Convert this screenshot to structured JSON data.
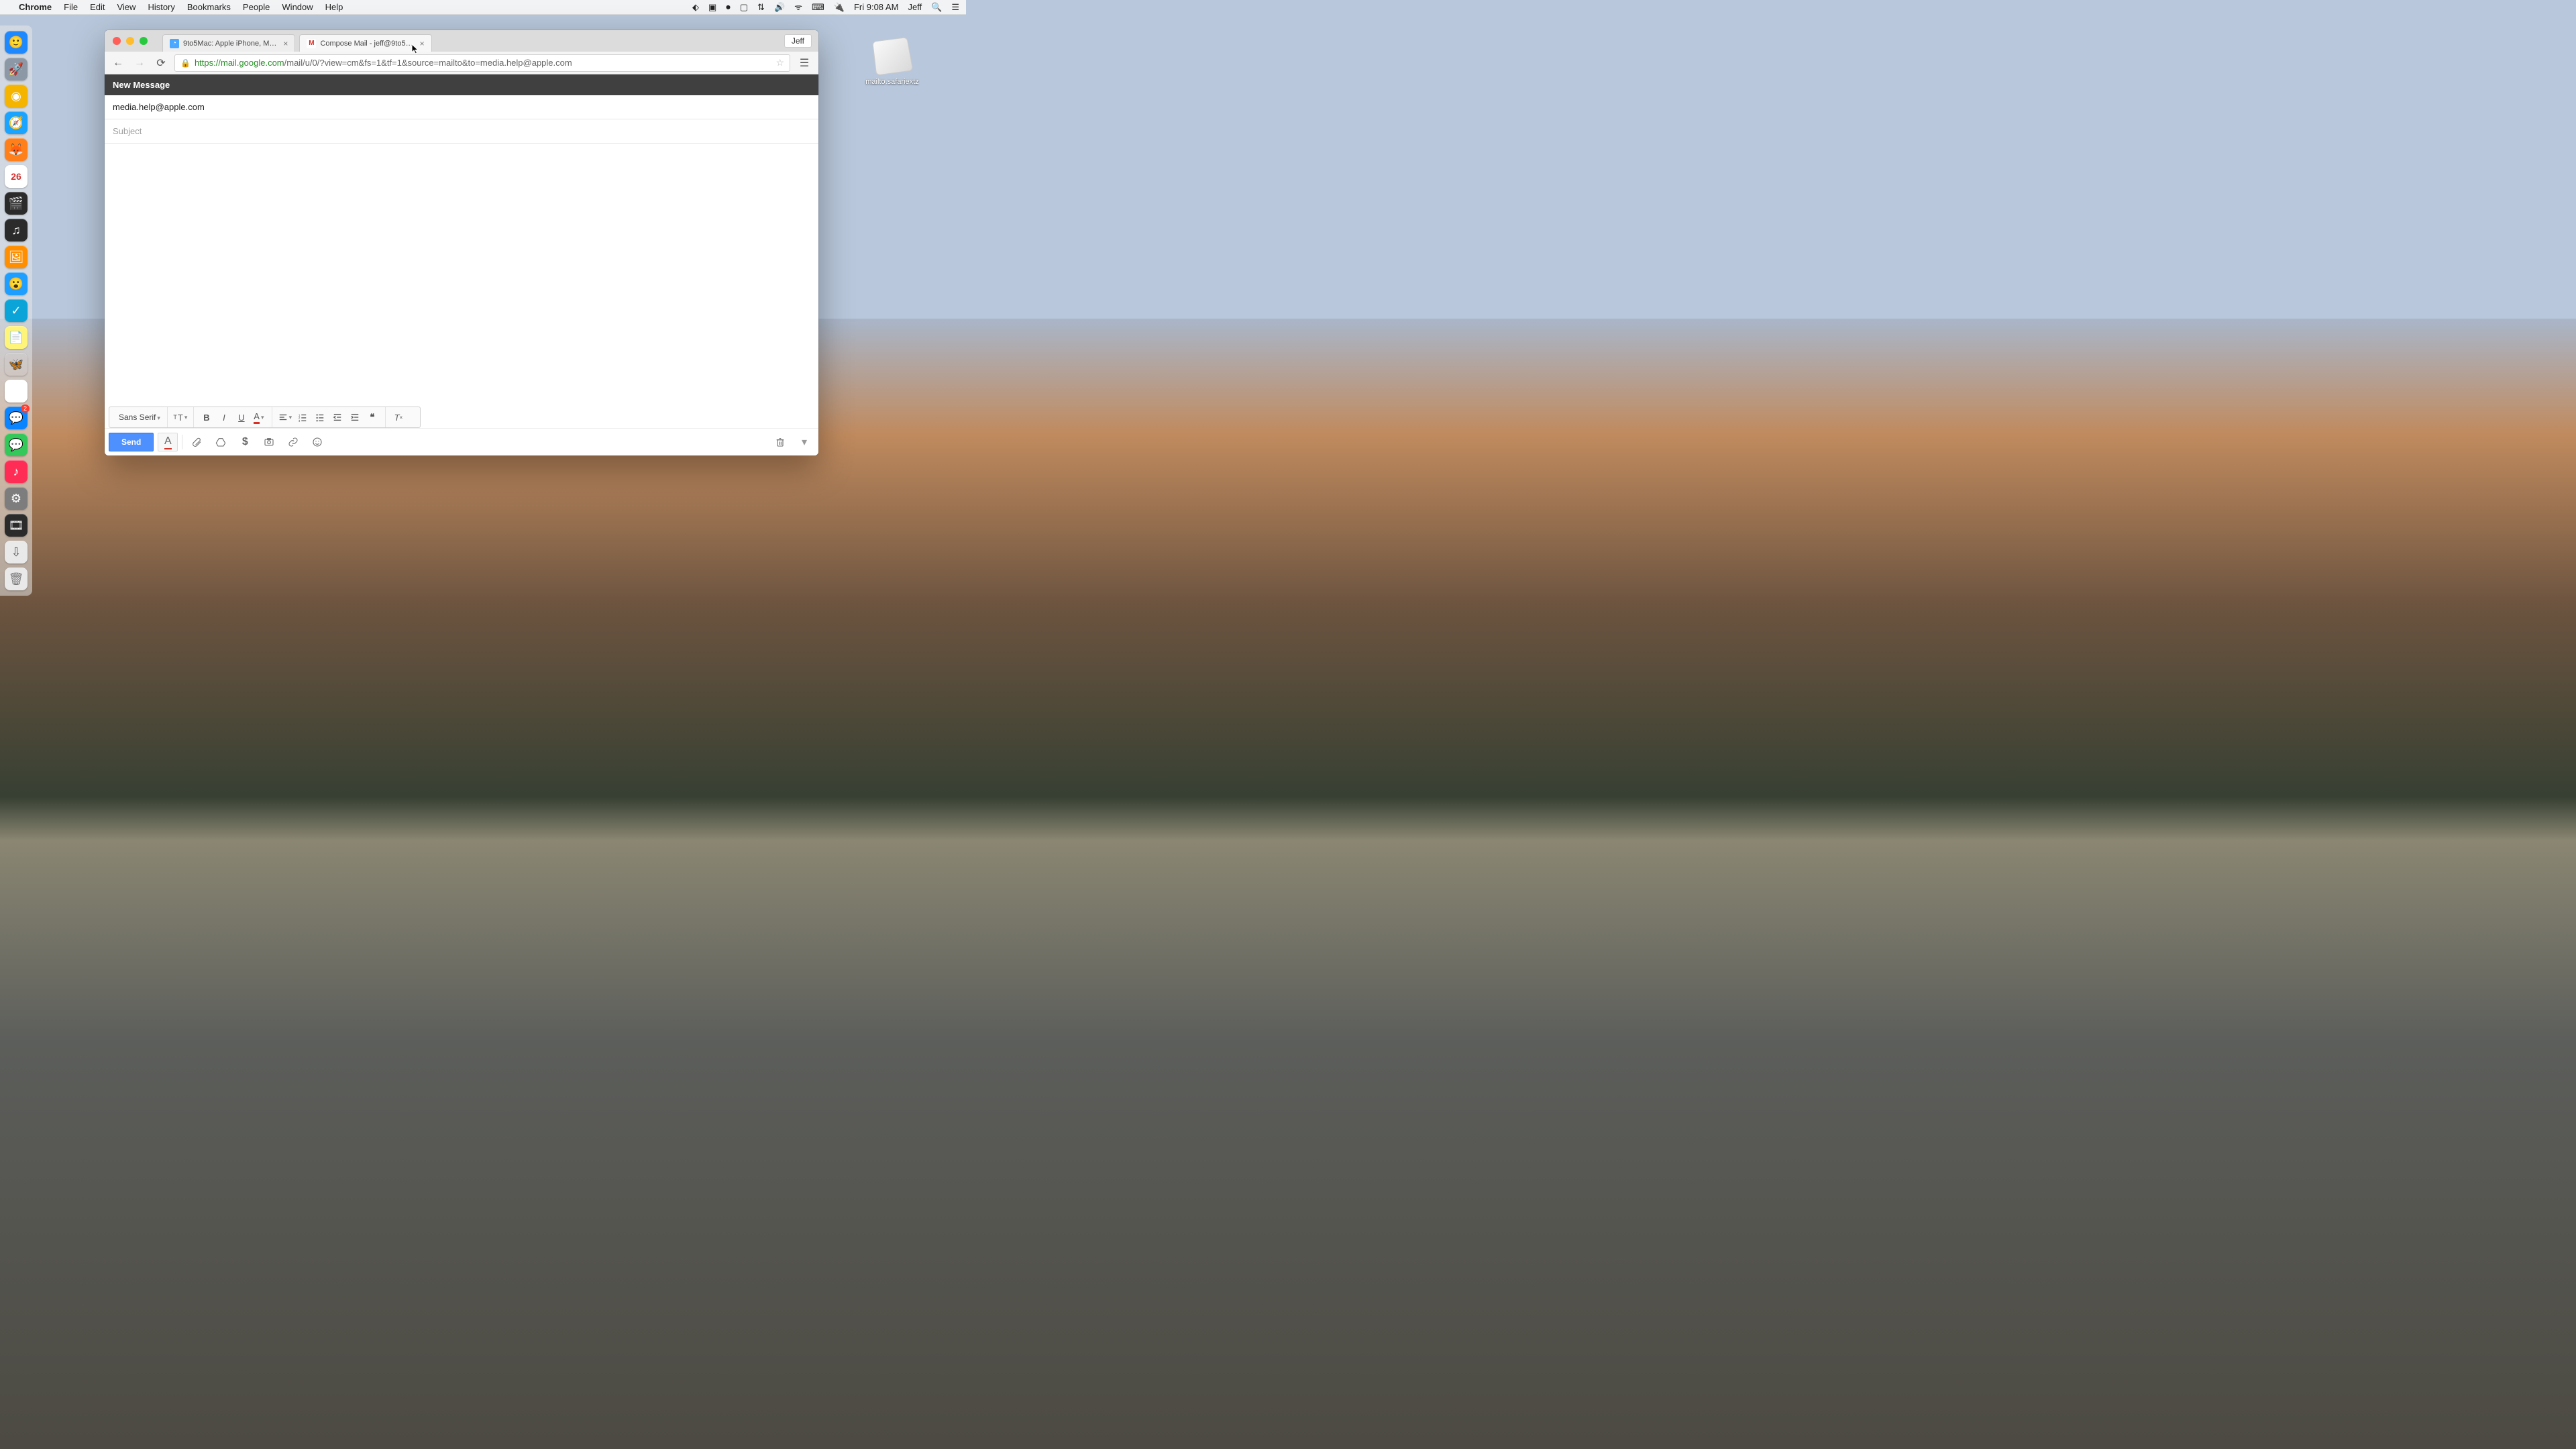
{
  "menubar": {
    "app": "Chrome",
    "items": [
      "File",
      "Edit",
      "View",
      "History",
      "Bookmarks",
      "People",
      "Window",
      "Help"
    ],
    "clock": "Fri 9:08 AM",
    "user": "Jeff"
  },
  "dock": {
    "items": [
      {
        "name": "finder",
        "glyph": "🙂",
        "bg": "#1e88ff"
      },
      {
        "name": "launchpad",
        "glyph": "🚀",
        "bg": "#8d98a6"
      },
      {
        "name": "chrome",
        "glyph": "◉",
        "bg": "#f4b400"
      },
      {
        "name": "safari",
        "glyph": "🧭",
        "bg": "#1aa3ff"
      },
      {
        "name": "firefox",
        "glyph": "🦊",
        "bg": "#ff7f1a"
      },
      {
        "name": "calendar",
        "glyph": "26",
        "bg": "#ffffff",
        "fg": "#d32f2f"
      },
      {
        "name": "final-cut",
        "glyph": "🎬",
        "bg": "#2b2b2b"
      },
      {
        "name": "logic",
        "glyph": "♫",
        "bg": "#2b2b2b"
      },
      {
        "name": "preview",
        "glyph": "🖼",
        "bg": "#ff8f00"
      },
      {
        "name": "app-blue",
        "glyph": "😮",
        "bg": "#1e9eff"
      },
      {
        "name": "things",
        "glyph": "✓",
        "bg": "#0aa4d8"
      },
      {
        "name": "notes",
        "glyph": "📄",
        "bg": "#fff47a",
        "fg": "#444"
      },
      {
        "name": "butterfly",
        "glyph": "🦋",
        "bg": "#ffffff00"
      },
      {
        "name": "photos",
        "glyph": "✿",
        "bg": "#ffffff"
      },
      {
        "name": "messages-alt",
        "glyph": "💬",
        "bg": "#0a84ff",
        "badge": "2"
      },
      {
        "name": "messages",
        "glyph": "💬",
        "bg": "#34c759"
      },
      {
        "name": "itunes",
        "glyph": "♪",
        "bg": "#ff2d55"
      },
      {
        "name": "settings",
        "glyph": "⚙",
        "bg": "#7d7d7d"
      },
      {
        "name": "quicktime",
        "glyph": "🎞",
        "bg": "#2b2b2b"
      },
      {
        "name": "downloads",
        "glyph": "⇩",
        "bg": "#e9e9e9",
        "fg": "#555"
      },
      {
        "name": "trash",
        "glyph": "🗑",
        "bg": "#e9e9e9",
        "fg": "#777"
      }
    ]
  },
  "desktop_file": {
    "label": "mailto.safariextz"
  },
  "chrome": {
    "traffic": {
      "close": "#ff5f57",
      "min": "#ffbd2e",
      "max": "#28c940"
    },
    "tabs": [
      {
        "title": "9to5Mac: Apple iPhone, M…",
        "favicon": "◔",
        "favicon_bg": "#4aa8ff",
        "active": false,
        "closeable": true
      },
      {
        "title": "Compose Mail - jeff@9to5…",
        "favicon": "M",
        "favicon_bg": "#ffffff",
        "favicon_fg": "#d93025",
        "active": true,
        "closeable": true
      }
    ],
    "profile_label": "Jeff",
    "nav": {
      "back": true,
      "forward": false,
      "reload": true
    },
    "url": {
      "https": "https://",
      "host": "mail.google.com",
      "path": "/mail/u/0/?view=cm&fs=1&tf=1&source=mailto&to=media.help@apple.com"
    }
  },
  "compose": {
    "header": "New Message",
    "to": "media.help@apple.com",
    "subject_placeholder": "Subject",
    "subject": "",
    "body": ""
  },
  "formatting": {
    "font_label": "Sans Serif"
  },
  "actions": {
    "send": "Send"
  }
}
